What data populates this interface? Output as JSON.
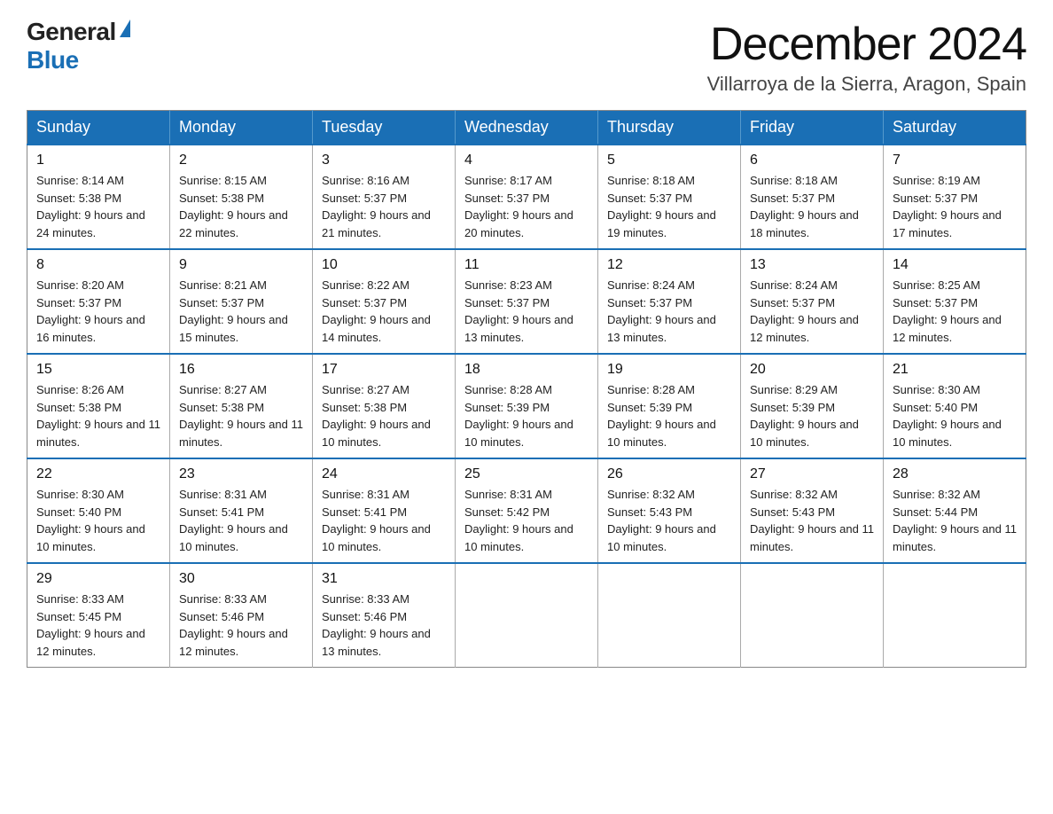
{
  "header": {
    "logo": {
      "general": "General",
      "blue": "Blue",
      "triangle": true
    },
    "title": "December 2024",
    "subtitle": "Villarroya de la Sierra, Aragon, Spain"
  },
  "calendar": {
    "days_of_week": [
      "Sunday",
      "Monday",
      "Tuesday",
      "Wednesday",
      "Thursday",
      "Friday",
      "Saturday"
    ],
    "weeks": [
      [
        {
          "day": "1",
          "sunrise": "8:14 AM",
          "sunset": "5:38 PM",
          "daylight": "9 hours and 24 minutes."
        },
        {
          "day": "2",
          "sunrise": "8:15 AM",
          "sunset": "5:38 PM",
          "daylight": "9 hours and 22 minutes."
        },
        {
          "day": "3",
          "sunrise": "8:16 AM",
          "sunset": "5:37 PM",
          "daylight": "9 hours and 21 minutes."
        },
        {
          "day": "4",
          "sunrise": "8:17 AM",
          "sunset": "5:37 PM",
          "daylight": "9 hours and 20 minutes."
        },
        {
          "day": "5",
          "sunrise": "8:18 AM",
          "sunset": "5:37 PM",
          "daylight": "9 hours and 19 minutes."
        },
        {
          "day": "6",
          "sunrise": "8:18 AM",
          "sunset": "5:37 PM",
          "daylight": "9 hours and 18 minutes."
        },
        {
          "day": "7",
          "sunrise": "8:19 AM",
          "sunset": "5:37 PM",
          "daylight": "9 hours and 17 minutes."
        }
      ],
      [
        {
          "day": "8",
          "sunrise": "8:20 AM",
          "sunset": "5:37 PM",
          "daylight": "9 hours and 16 minutes."
        },
        {
          "day": "9",
          "sunrise": "8:21 AM",
          "sunset": "5:37 PM",
          "daylight": "9 hours and 15 minutes."
        },
        {
          "day": "10",
          "sunrise": "8:22 AM",
          "sunset": "5:37 PM",
          "daylight": "9 hours and 14 minutes."
        },
        {
          "day": "11",
          "sunrise": "8:23 AM",
          "sunset": "5:37 PM",
          "daylight": "9 hours and 13 minutes."
        },
        {
          "day": "12",
          "sunrise": "8:24 AM",
          "sunset": "5:37 PM",
          "daylight": "9 hours and 13 minutes."
        },
        {
          "day": "13",
          "sunrise": "8:24 AM",
          "sunset": "5:37 PM",
          "daylight": "9 hours and 12 minutes."
        },
        {
          "day": "14",
          "sunrise": "8:25 AM",
          "sunset": "5:37 PM",
          "daylight": "9 hours and 12 minutes."
        }
      ],
      [
        {
          "day": "15",
          "sunrise": "8:26 AM",
          "sunset": "5:38 PM",
          "daylight": "9 hours and 11 minutes."
        },
        {
          "day": "16",
          "sunrise": "8:27 AM",
          "sunset": "5:38 PM",
          "daylight": "9 hours and 11 minutes."
        },
        {
          "day": "17",
          "sunrise": "8:27 AM",
          "sunset": "5:38 PM",
          "daylight": "9 hours and 10 minutes."
        },
        {
          "day": "18",
          "sunrise": "8:28 AM",
          "sunset": "5:39 PM",
          "daylight": "9 hours and 10 minutes."
        },
        {
          "day": "19",
          "sunrise": "8:28 AM",
          "sunset": "5:39 PM",
          "daylight": "9 hours and 10 minutes."
        },
        {
          "day": "20",
          "sunrise": "8:29 AM",
          "sunset": "5:39 PM",
          "daylight": "9 hours and 10 minutes."
        },
        {
          "day": "21",
          "sunrise": "8:30 AM",
          "sunset": "5:40 PM",
          "daylight": "9 hours and 10 minutes."
        }
      ],
      [
        {
          "day": "22",
          "sunrise": "8:30 AM",
          "sunset": "5:40 PM",
          "daylight": "9 hours and 10 minutes."
        },
        {
          "day": "23",
          "sunrise": "8:31 AM",
          "sunset": "5:41 PM",
          "daylight": "9 hours and 10 minutes."
        },
        {
          "day": "24",
          "sunrise": "8:31 AM",
          "sunset": "5:41 PM",
          "daylight": "9 hours and 10 minutes."
        },
        {
          "day": "25",
          "sunrise": "8:31 AM",
          "sunset": "5:42 PM",
          "daylight": "9 hours and 10 minutes."
        },
        {
          "day": "26",
          "sunrise": "8:32 AM",
          "sunset": "5:43 PM",
          "daylight": "9 hours and 10 minutes."
        },
        {
          "day": "27",
          "sunrise": "8:32 AM",
          "sunset": "5:43 PM",
          "daylight": "9 hours and 11 minutes."
        },
        {
          "day": "28",
          "sunrise": "8:32 AM",
          "sunset": "5:44 PM",
          "daylight": "9 hours and 11 minutes."
        }
      ],
      [
        {
          "day": "29",
          "sunrise": "8:33 AM",
          "sunset": "5:45 PM",
          "daylight": "9 hours and 12 minutes."
        },
        {
          "day": "30",
          "sunrise": "8:33 AM",
          "sunset": "5:46 PM",
          "daylight": "9 hours and 12 minutes."
        },
        {
          "day": "31",
          "sunrise": "8:33 AM",
          "sunset": "5:46 PM",
          "daylight": "9 hours and 13 minutes."
        },
        null,
        null,
        null,
        null
      ]
    ]
  }
}
